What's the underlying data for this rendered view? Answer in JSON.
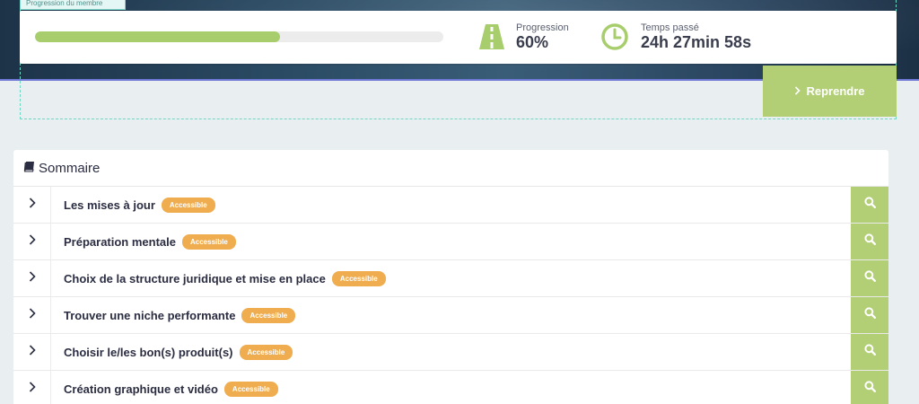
{
  "header": {
    "member_progress_label": "Progression du membre",
    "progress": {
      "label": "Progression",
      "value_text": "60%",
      "fraction": 0.6
    },
    "time_spent": {
      "label": "Temps passé",
      "value_text": "24h 27min 58s"
    },
    "resume_label": "Reprendre"
  },
  "summary": {
    "title": "Sommaire",
    "modules": [
      {
        "title": "Les mises à jour",
        "badge": "Accessible"
      },
      {
        "title": "Préparation mentale",
        "badge": "Accessible"
      },
      {
        "title": "Choix de la structure juridique et mise en place",
        "badge": "Accessible"
      },
      {
        "title": "Trouver une niche performante",
        "badge": "Accessible"
      },
      {
        "title": "Choisir le/les bon(s) produit(s)",
        "badge": "Accessible"
      },
      {
        "title": "Création graphique et vidéo",
        "badge": "Accessible"
      }
    ]
  },
  "icons": {
    "progress": "road-icon",
    "time": "clock-icon",
    "resume": "chevron-right-icon",
    "summary": "book-icon",
    "row_toggle": "chevron-right-icon",
    "row_action": "search-icon"
  },
  "colors": {
    "accent_green": "#b2cf76",
    "badge_orange": "#efad4f",
    "progress_track": "#ececec",
    "page_background": "#e9eef1"
  }
}
